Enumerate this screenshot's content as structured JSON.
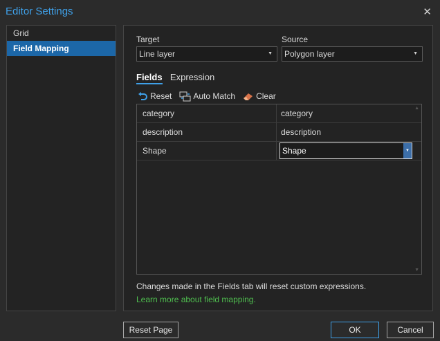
{
  "window": {
    "title": "Editor Settings",
    "close_glyph": "✕"
  },
  "sidebar": {
    "items": [
      {
        "label": "Grid",
        "active": false
      },
      {
        "label": "Field Mapping",
        "active": true
      }
    ]
  },
  "target": {
    "label": "Target",
    "value": "Line layer"
  },
  "source": {
    "label": "Source",
    "value": "Polygon layer"
  },
  "tabs": [
    {
      "label": "Fields",
      "active": true
    },
    {
      "label": "Expression",
      "active": false
    }
  ],
  "toolbar": {
    "reset_label": "Reset",
    "auto_match_label": "Auto Match",
    "clear_label": "Clear"
  },
  "grid": {
    "rows": [
      {
        "target_field": "category",
        "source_field": "category"
      },
      {
        "target_field": "description",
        "source_field": "description"
      },
      {
        "target_field": "Shape",
        "source_field": "Shape",
        "editing": true
      }
    ]
  },
  "footer_note": "Changes made in the Fields tab will reset custom expressions.",
  "learn_more_link": "Learn more about field mapping.",
  "buttons": {
    "reset_page": "Reset Page",
    "ok": "OK",
    "cancel": "Cancel"
  },
  "colors": {
    "accent": "#3fa0e8",
    "selected": "#1c67a8",
    "link": "#4fbf4f"
  }
}
